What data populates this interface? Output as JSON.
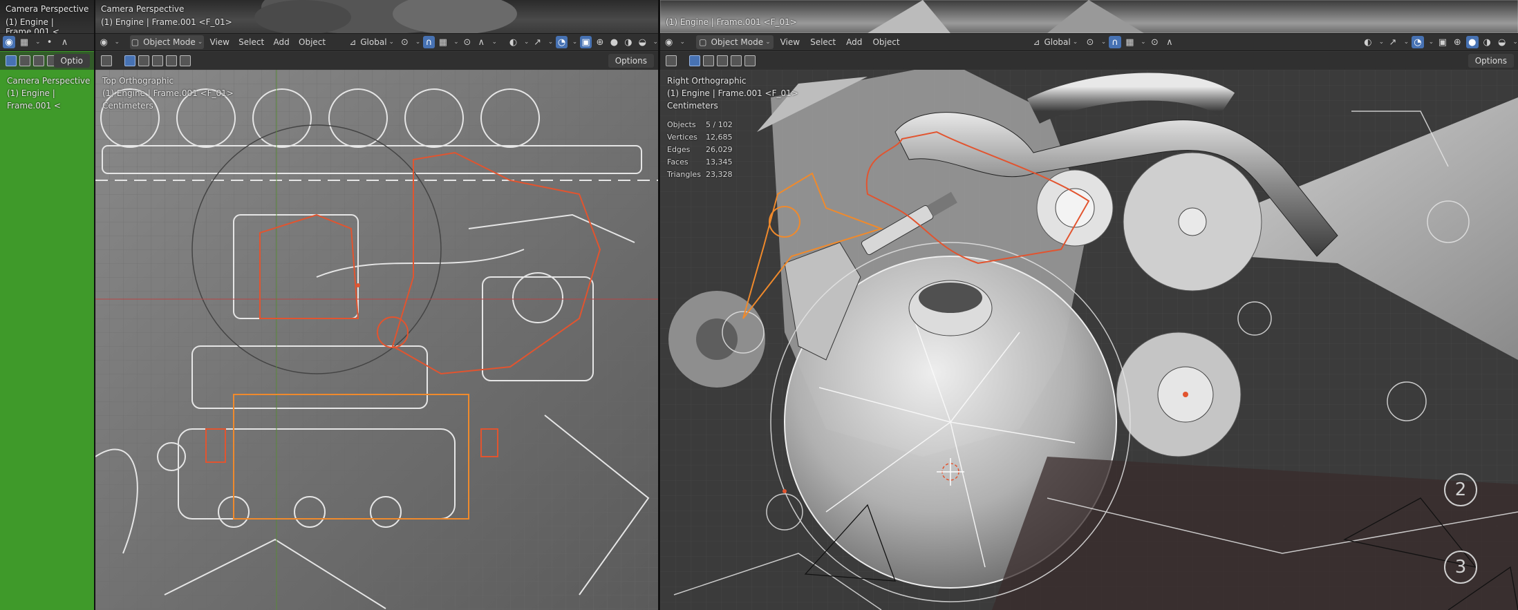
{
  "left_area": {
    "strip_title": "Camera Perspective",
    "strip_sub": "(1) Engine | Frame.001 <",
    "overlay_title": "Camera Perspective",
    "overlay_sub": "(1) Engine | Frame.001 <",
    "options": "Optio"
  },
  "mid_area": {
    "strip_title": "Camera Perspective",
    "strip_sub": "(1) Engine | Frame.001 <F_01>",
    "mode": "Object Mode",
    "menu": [
      "View",
      "Select",
      "Add",
      "Object"
    ],
    "orientation": "Global",
    "options": "Options",
    "view_name": "Top Orthographic",
    "view_sub": "(1) Engine | Frame.001 <F_01>",
    "units": "Centimeters"
  },
  "right_area": {
    "strip_sub": "(1) Engine | Frame.001 <F_01>",
    "mode": "Object Mode",
    "menu": [
      "View",
      "Select",
      "Add",
      "Object"
    ],
    "orientation": "Global",
    "options": "Options",
    "view_name": "Right Orthographic",
    "view_sub": "(1) Engine | Frame.001 <F_01>",
    "units": "Centimeters",
    "stats": [
      {
        "key": "Objects",
        "value": "5 / 102"
      },
      {
        "key": "Vertices",
        "value": "12,685"
      },
      {
        "key": "Edges",
        "value": "26,029"
      },
      {
        "key": "Faces",
        "value": "13,345"
      },
      {
        "key": "Triangles",
        "value": "23,328"
      }
    ],
    "circle_labels": [
      "2",
      "3"
    ]
  },
  "icons": {
    "editor_type": "viewport-editor-icon",
    "snap": "magnet-icon",
    "proportional": "falloff-icon",
    "overlay": "overlay-icon",
    "xray": "xray-icon",
    "shading": [
      "wireframe-shading-icon",
      "solid-shading-icon",
      "material-shading-icon",
      "rendered-shading-icon"
    ]
  },
  "colors": {
    "accent": "#4772b3",
    "header_bg": "#303030",
    "green_view": "#3f9a2a",
    "selection_orange": "#f08a2c",
    "active_red": "#e2542f"
  }
}
